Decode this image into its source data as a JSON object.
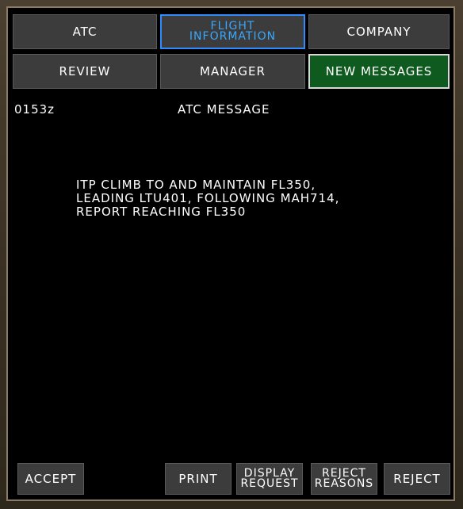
{
  "tabs": {
    "atc": "ATC",
    "flight_information": "FLIGHT\nINFORMATION",
    "company": "COMPANY"
  },
  "subtabs": {
    "review": "REVIEW",
    "manager": "MANAGER",
    "new_messages": "NEW MESSAGES"
  },
  "message": {
    "time": "0153z",
    "header": "ATC MESSAGE",
    "lines": [
      "ITP CLIMB TO AND MAINTAIN FL350,",
      "LEADING LTU401, FOLLOWING MAH714,",
      "REPORT REACHING FL350"
    ]
  },
  "actions": {
    "accept": "ACCEPT",
    "print": "PRINT",
    "display_request": "DISPLAY\nREQUEST",
    "reject_reasons": "REJECT\nREASONS",
    "reject": "REJECT"
  },
  "colors": {
    "selected_tab_border": "#2e8cff",
    "selected_tab_text": "#38a8ff",
    "selected_item_bg": "#0f5a1e",
    "button_bg": "#3c3c3c",
    "screen_bg": "#000000"
  }
}
